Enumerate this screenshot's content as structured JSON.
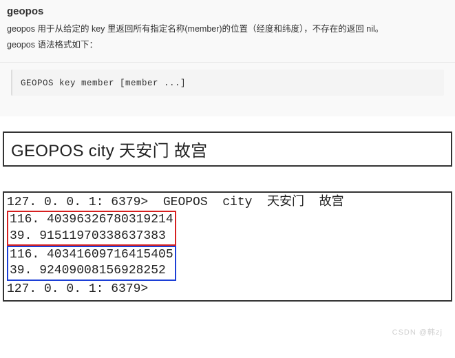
{
  "header": {
    "title": "geopos",
    "desc_line1": "geopos 用于从给定的 key 里返回所有指定名称(member)的位置（经度和纬度），不存在的返回 nil。",
    "desc_line2": "geopos 语法格式如下："
  },
  "code": {
    "syntax": "GEOPOS key member [member ...]"
  },
  "example": {
    "heading": "GEOPOS city 天安门 故宫",
    "prompt1": "127. 0. 0. 1: 6379>  GEOPOS  city  天安门  故宫",
    "result1_line1": "116. 40396326780319214",
    "result1_line2": "39. 91511970338637383",
    "result2_line1": "116. 40341609716415405",
    "result2_line2": "39. 92409008156928252",
    "prompt2": "127. 0. 0. 1: 6379>"
  },
  "watermark": "CSDN @韩zj"
}
